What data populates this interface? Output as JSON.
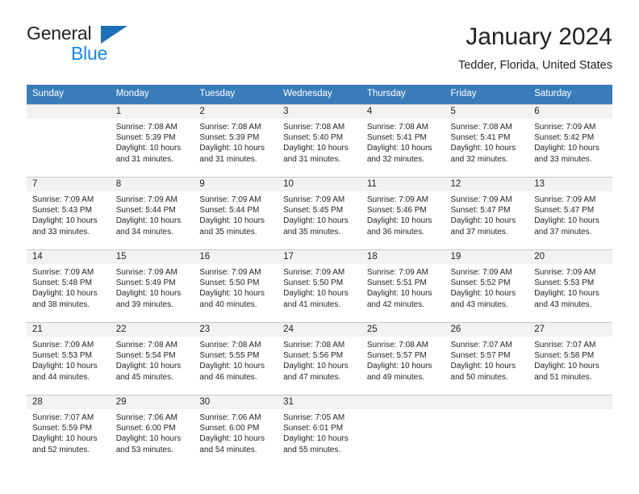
{
  "brand": {
    "name_dark": "General",
    "name_light": "Blue"
  },
  "header": {
    "title": "January 2024",
    "subtitle": "Tedder, Florida, United States"
  },
  "colors": {
    "header_blue": "#3a7cba",
    "logo_blue": "#1b87dd",
    "logo_triangle": "#1b70b8",
    "daynum_band": "#f2f2f2",
    "cell_border": "#c8c8c8",
    "text": "#231f20"
  },
  "weekdays": [
    "Sunday",
    "Monday",
    "Tuesday",
    "Wednesday",
    "Thursday",
    "Friday",
    "Saturday"
  ],
  "labels": {
    "sunrise_prefix": "Sunrise:",
    "sunset_prefix": "Sunset:",
    "daylight_prefix": "Daylight:"
  },
  "weeks": [
    [
      {
        "day": "",
        "line1": "",
        "line2": "",
        "line3": "",
        "line4": ""
      },
      {
        "day": "1",
        "line1": "Sunrise: 7:08 AM",
        "line2": "Sunset: 5:39 PM",
        "line3": "Daylight: 10 hours",
        "line4": "and 31 minutes."
      },
      {
        "day": "2",
        "line1": "Sunrise: 7:08 AM",
        "line2": "Sunset: 5:39 PM",
        "line3": "Daylight: 10 hours",
        "line4": "and 31 minutes."
      },
      {
        "day": "3",
        "line1": "Sunrise: 7:08 AM",
        "line2": "Sunset: 5:40 PM",
        "line3": "Daylight: 10 hours",
        "line4": "and 31 minutes."
      },
      {
        "day": "4",
        "line1": "Sunrise: 7:08 AM",
        "line2": "Sunset: 5:41 PM",
        "line3": "Daylight: 10 hours",
        "line4": "and 32 minutes."
      },
      {
        "day": "5",
        "line1": "Sunrise: 7:08 AM",
        "line2": "Sunset: 5:41 PM",
        "line3": "Daylight: 10 hours",
        "line4": "and 32 minutes."
      },
      {
        "day": "6",
        "line1": "Sunrise: 7:09 AM",
        "line2": "Sunset: 5:42 PM",
        "line3": "Daylight: 10 hours",
        "line4": "and 33 minutes."
      }
    ],
    [
      {
        "day": "7",
        "line1": "Sunrise: 7:09 AM",
        "line2": "Sunset: 5:43 PM",
        "line3": "Daylight: 10 hours",
        "line4": "and 33 minutes."
      },
      {
        "day": "8",
        "line1": "Sunrise: 7:09 AM",
        "line2": "Sunset: 5:44 PM",
        "line3": "Daylight: 10 hours",
        "line4": "and 34 minutes."
      },
      {
        "day": "9",
        "line1": "Sunrise: 7:09 AM",
        "line2": "Sunset: 5:44 PM",
        "line3": "Daylight: 10 hours",
        "line4": "and 35 minutes."
      },
      {
        "day": "10",
        "line1": "Sunrise: 7:09 AM",
        "line2": "Sunset: 5:45 PM",
        "line3": "Daylight: 10 hours",
        "line4": "and 35 minutes."
      },
      {
        "day": "11",
        "line1": "Sunrise: 7:09 AM",
        "line2": "Sunset: 5:46 PM",
        "line3": "Daylight: 10 hours",
        "line4": "and 36 minutes."
      },
      {
        "day": "12",
        "line1": "Sunrise: 7:09 AM",
        "line2": "Sunset: 5:47 PM",
        "line3": "Daylight: 10 hours",
        "line4": "and 37 minutes."
      },
      {
        "day": "13",
        "line1": "Sunrise: 7:09 AM",
        "line2": "Sunset: 5:47 PM",
        "line3": "Daylight: 10 hours",
        "line4": "and 37 minutes."
      }
    ],
    [
      {
        "day": "14",
        "line1": "Sunrise: 7:09 AM",
        "line2": "Sunset: 5:48 PM",
        "line3": "Daylight: 10 hours",
        "line4": "and 38 minutes."
      },
      {
        "day": "15",
        "line1": "Sunrise: 7:09 AM",
        "line2": "Sunset: 5:49 PM",
        "line3": "Daylight: 10 hours",
        "line4": "and 39 minutes."
      },
      {
        "day": "16",
        "line1": "Sunrise: 7:09 AM",
        "line2": "Sunset: 5:50 PM",
        "line3": "Daylight: 10 hours",
        "line4": "and 40 minutes."
      },
      {
        "day": "17",
        "line1": "Sunrise: 7:09 AM",
        "line2": "Sunset: 5:50 PM",
        "line3": "Daylight: 10 hours",
        "line4": "and 41 minutes."
      },
      {
        "day": "18",
        "line1": "Sunrise: 7:09 AM",
        "line2": "Sunset: 5:51 PM",
        "line3": "Daylight: 10 hours",
        "line4": "and 42 minutes."
      },
      {
        "day": "19",
        "line1": "Sunrise: 7:09 AM",
        "line2": "Sunset: 5:52 PM",
        "line3": "Daylight: 10 hours",
        "line4": "and 43 minutes."
      },
      {
        "day": "20",
        "line1": "Sunrise: 7:09 AM",
        "line2": "Sunset: 5:53 PM",
        "line3": "Daylight: 10 hours",
        "line4": "and 43 minutes."
      }
    ],
    [
      {
        "day": "21",
        "line1": "Sunrise: 7:09 AM",
        "line2": "Sunset: 5:53 PM",
        "line3": "Daylight: 10 hours",
        "line4": "and 44 minutes."
      },
      {
        "day": "22",
        "line1": "Sunrise: 7:08 AM",
        "line2": "Sunset: 5:54 PM",
        "line3": "Daylight: 10 hours",
        "line4": "and 45 minutes."
      },
      {
        "day": "23",
        "line1": "Sunrise: 7:08 AM",
        "line2": "Sunset: 5:55 PM",
        "line3": "Daylight: 10 hours",
        "line4": "and 46 minutes."
      },
      {
        "day": "24",
        "line1": "Sunrise: 7:08 AM",
        "line2": "Sunset: 5:56 PM",
        "line3": "Daylight: 10 hours",
        "line4": "and 47 minutes."
      },
      {
        "day": "25",
        "line1": "Sunrise: 7:08 AM",
        "line2": "Sunset: 5:57 PM",
        "line3": "Daylight: 10 hours",
        "line4": "and 49 minutes."
      },
      {
        "day": "26",
        "line1": "Sunrise: 7:07 AM",
        "line2": "Sunset: 5:57 PM",
        "line3": "Daylight: 10 hours",
        "line4": "and 50 minutes."
      },
      {
        "day": "27",
        "line1": "Sunrise: 7:07 AM",
        "line2": "Sunset: 5:58 PM",
        "line3": "Daylight: 10 hours",
        "line4": "and 51 minutes."
      }
    ],
    [
      {
        "day": "28",
        "line1": "Sunrise: 7:07 AM",
        "line2": "Sunset: 5:59 PM",
        "line3": "Daylight: 10 hours",
        "line4": "and 52 minutes."
      },
      {
        "day": "29",
        "line1": "Sunrise: 7:06 AM",
        "line2": "Sunset: 6:00 PM",
        "line3": "Daylight: 10 hours",
        "line4": "and 53 minutes."
      },
      {
        "day": "30",
        "line1": "Sunrise: 7:06 AM",
        "line2": "Sunset: 6:00 PM",
        "line3": "Daylight: 10 hours",
        "line4": "and 54 minutes."
      },
      {
        "day": "31",
        "line1": "Sunrise: 7:05 AM",
        "line2": "Sunset: 6:01 PM",
        "line3": "Daylight: 10 hours",
        "line4": "and 55 minutes."
      },
      {
        "day": "",
        "line1": "",
        "line2": "",
        "line3": "",
        "line4": ""
      },
      {
        "day": "",
        "line1": "",
        "line2": "",
        "line3": "",
        "line4": ""
      },
      {
        "day": "",
        "line1": "",
        "line2": "",
        "line3": "",
        "line4": ""
      }
    ]
  ]
}
